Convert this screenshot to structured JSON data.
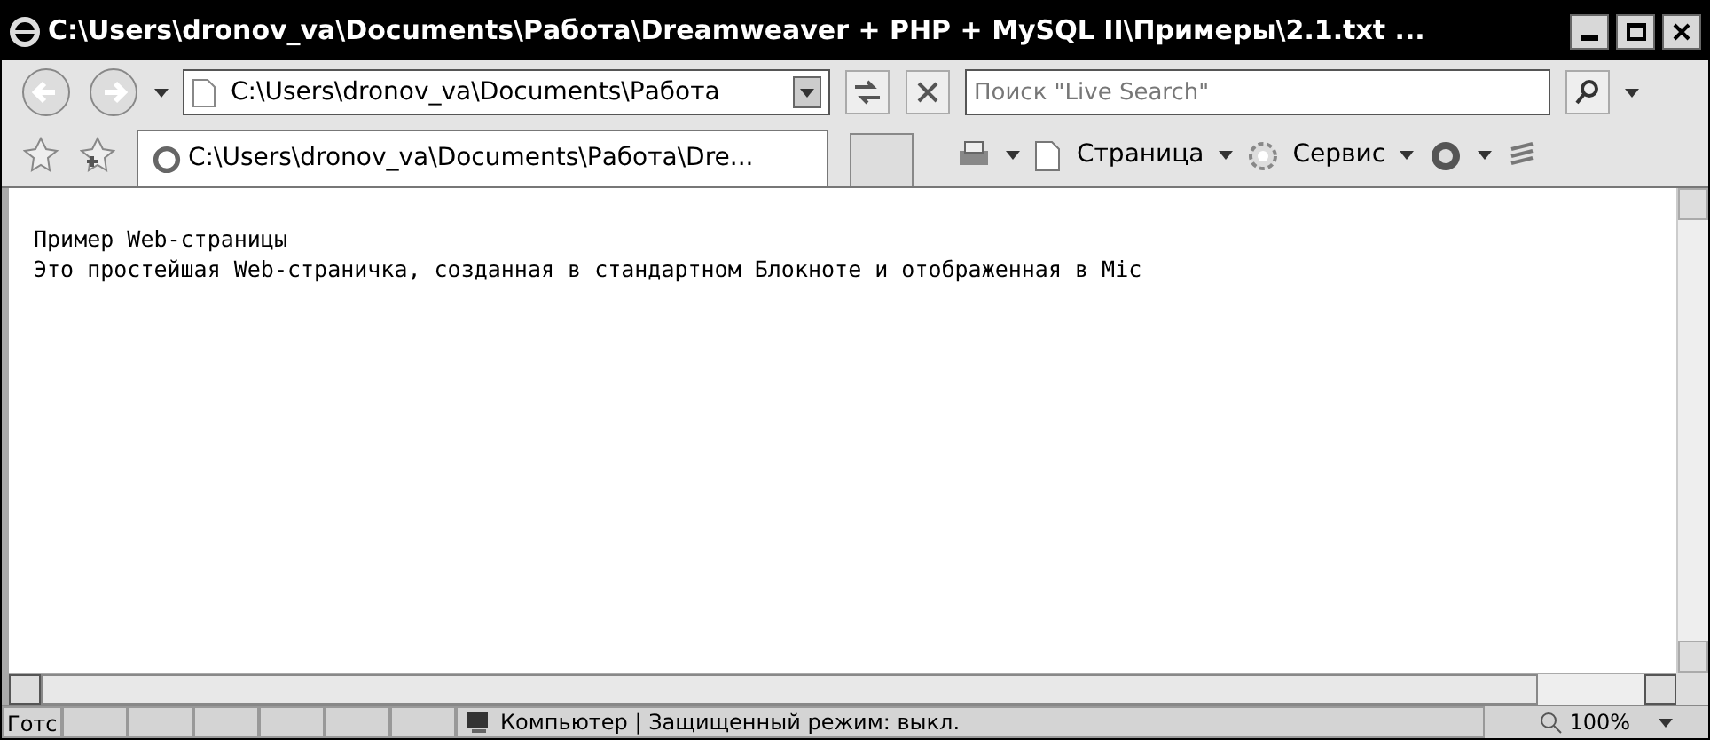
{
  "window": {
    "title": "C:\\Users\\dronov_va\\Documents\\Работа\\Dreamweaver + PHP + MySQL II\\Примеры\\2.1.txt ..."
  },
  "address_bar": {
    "value": "C:\\Users\\dronov_va\\Documents\\Работа"
  },
  "search": {
    "placeholder": "Поиск \"Live Search\""
  },
  "tabs": [
    {
      "label": "C:\\Users\\dronov_va\\Documents\\Работа\\Dre...",
      "selected": true
    }
  ],
  "toolbar": {
    "page": "Страница",
    "tools": "Сервис"
  },
  "document": {
    "lines": [
      "Пример Web-страницы",
      "Это простейшая Web-страничка, созданная в стандартном Блокноте и отображенная в Mic"
    ]
  },
  "status_bar": {
    "text": "Готс",
    "zone": "Компьютер | Защищенный режим: выкл.",
    "zoom": "100%"
  }
}
